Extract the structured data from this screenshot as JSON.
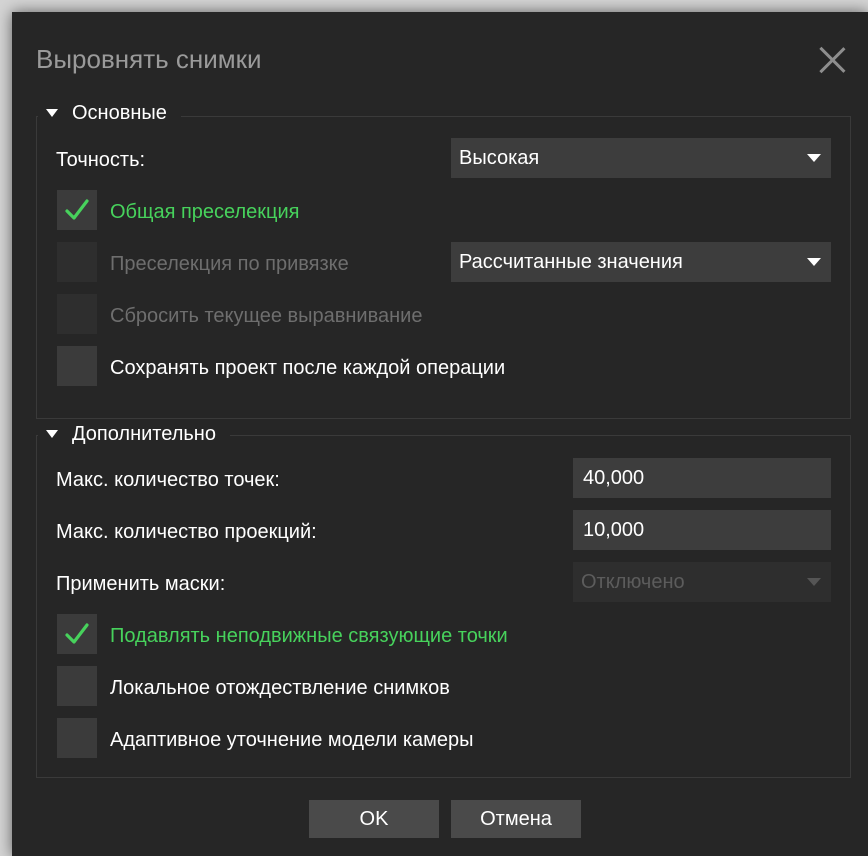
{
  "dialog": {
    "title": "Выровнять снимки",
    "close_icon": "close-icon"
  },
  "general": {
    "header": "Основные",
    "accuracy_label": "Точность:",
    "accuracy_value": "Высокая",
    "generic_preselection": {
      "label": "Общая преселекция",
      "checked": true
    },
    "reference_preselection": {
      "label": "Преселекция по привязке",
      "checked": false,
      "enabled": false,
      "mode_value": "Рассчитанные значения"
    },
    "reset_alignment": {
      "label": "Сбросить текущее выравнивание",
      "checked": false,
      "enabled": false
    },
    "save_after_each": {
      "label": "Сохранять проект после каждой операции",
      "checked": false
    }
  },
  "advanced": {
    "header": "Дополнительно",
    "keypoint_limit_label": "Макс. количество точек:",
    "keypoint_limit_value": "40,000",
    "tiepoint_limit_label": "Макс. количество проекций:",
    "tiepoint_limit_value": "10,000",
    "apply_masks_label": "Применить маски:",
    "apply_masks_value": "Отключено",
    "exclude_stationary": {
      "label": "Подавлять неподвижные связующие точки",
      "checked": true
    },
    "guided_matching": {
      "label": "Локальное отождествление снимков",
      "checked": false
    },
    "adaptive_fitting": {
      "label": "Адаптивное уточнение модели камеры",
      "checked": false
    }
  },
  "buttons": {
    "ok": "OK",
    "cancel": "Отмена"
  },
  "colors": {
    "background": "#262626",
    "control": "#3d3d3d",
    "checked_text": "#47d25c",
    "disabled_text": "#6e6e6e"
  }
}
